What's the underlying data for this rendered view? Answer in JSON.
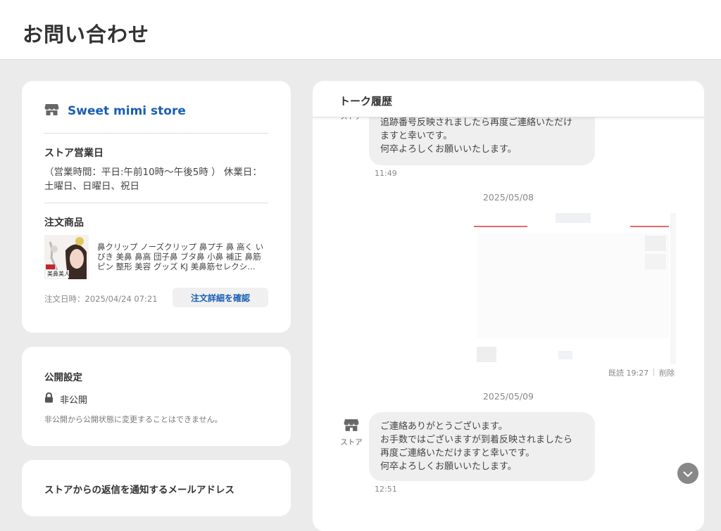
{
  "page": {
    "title": "お問い合わせ"
  },
  "store_card": {
    "store_name": "Sweet mimi store",
    "business_days_title": "ストア営業日",
    "business_hours": "（営業時間：平日:午前10時〜午後5時 ） 休業日：土曜日、日曜日、祝日",
    "order_title": "注文商品",
    "product_name": "鼻クリップ ノーズクリップ 鼻プチ 鼻 高く いびき 美鼻 鼻高 団子鼻 ブタ鼻 小鼻 補正 鼻筋ピン 整形 美容 グッズ KJ 美鼻筋セレクシ…",
    "thumbnail_caption": "美鼻美人",
    "order_date": "注文日時：2025/04/24 07:21",
    "order_detail_button": "注文詳細を確認"
  },
  "public_card": {
    "title": "公開設定",
    "status": "非公開",
    "note": "非公開から公開状態に変更することはできません。"
  },
  "email_card": {
    "title": "ストアからの返信を通知するメールアドレス"
  },
  "talk": {
    "title": "トーク履歴",
    "store_label": "ストア",
    "messages": [
      {
        "lines": [
          "追跡番号反映されましたら再度ご連絡いただけ",
          "ますと幸いです。",
          "何卒よろしくお願いいたします。"
        ],
        "time": "11:49"
      },
      {
        "lines": [
          "ご連絡ありがとうございます。",
          "お手数ではございますが到着反映されましたら",
          "再度ご連絡いただけますと幸いです。",
          "何卒よろしくお願いいたします。"
        ],
        "time": "12:51"
      }
    ],
    "dates": [
      "2025/05/08",
      "2025/05/09"
    ],
    "user_image": {
      "read_label": "既読 19:27",
      "delete_label": "削除"
    }
  },
  "colors": {
    "accent": "#1a5fb4",
    "background": "#ebebeb",
    "bubble": "#efefef"
  }
}
